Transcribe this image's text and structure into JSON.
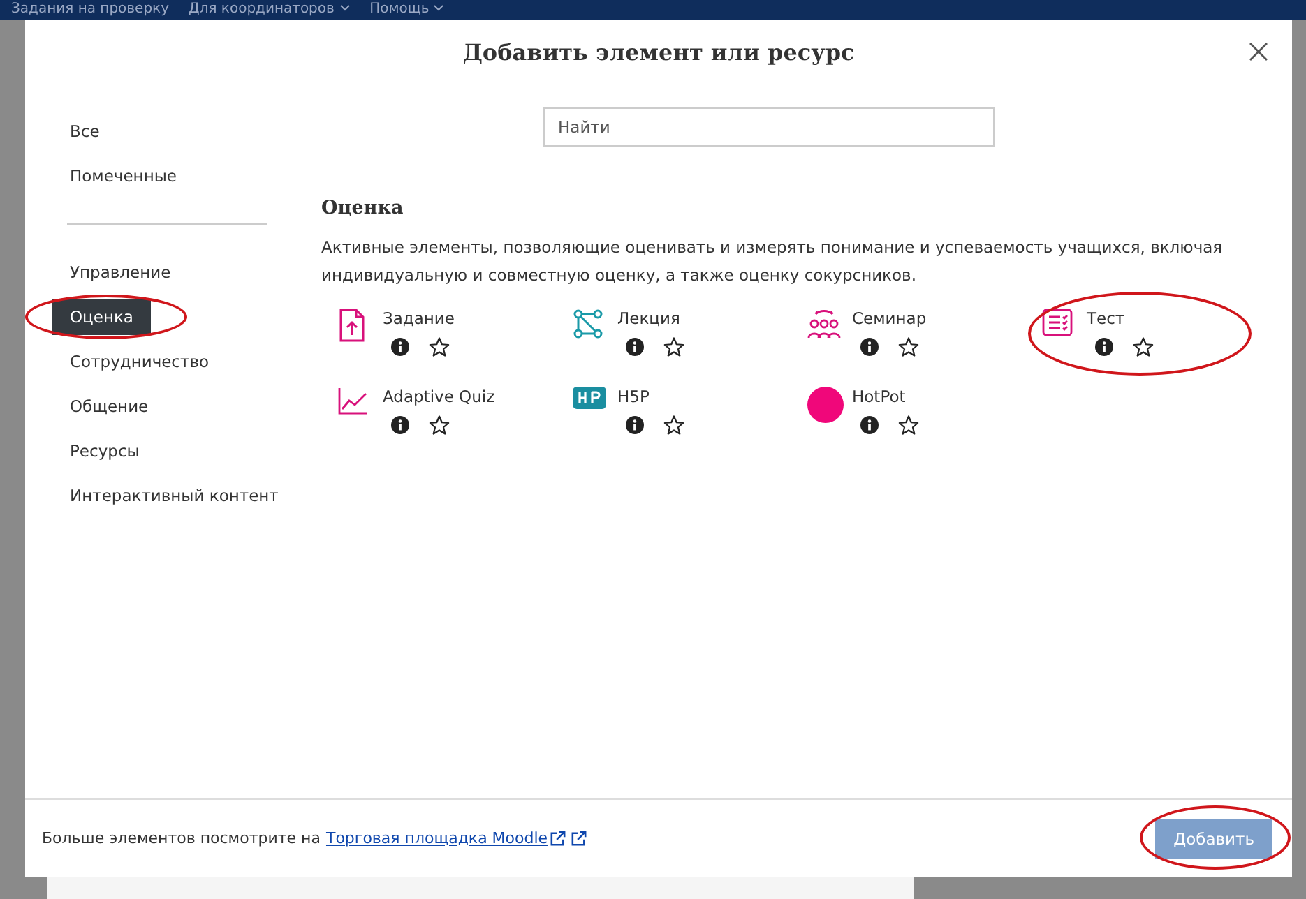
{
  "top_nav": [
    {
      "label": "Задания на проверку",
      "dropdown": false
    },
    {
      "label": "Для координаторов",
      "dropdown": true
    },
    {
      "label": "Помощь",
      "dropdown": true
    }
  ],
  "modal": {
    "title": "Добавить элемент или ресурс",
    "sidebar": {
      "filters": [
        {
          "label": "Все",
          "selected": false,
          "highlighted": false
        },
        {
          "label": "Помеченные",
          "selected": false,
          "highlighted": false
        }
      ],
      "categories": [
        {
          "label": "Управление",
          "selected": false,
          "highlighted": false
        },
        {
          "label": "Оценка",
          "selected": true,
          "highlighted": true
        },
        {
          "label": "Сотрудничество",
          "selected": false,
          "highlighted": false
        },
        {
          "label": "Общение",
          "selected": false,
          "highlighted": false
        },
        {
          "label": "Ресурсы",
          "selected": false,
          "highlighted": false
        },
        {
          "label": "Интерактивный контент",
          "selected": false,
          "highlighted": false
        }
      ]
    },
    "search": {
      "placeholder": "Найти"
    },
    "section": {
      "title": "Оценка",
      "description": "Активные элементы, позволяющие оценивать и измерять понимание и успеваемость учащихся, включая индивидуальную и совместную оценку, а также оценку сокурсников."
    },
    "items": [
      {
        "name": "Задание",
        "kind": "assignment",
        "starred": false,
        "highlighted": false
      },
      {
        "name": "Лекция",
        "kind": "lesson",
        "starred": false,
        "highlighted": false
      },
      {
        "name": "Семинар",
        "kind": "workshop",
        "starred": false,
        "highlighted": false
      },
      {
        "name": "Тест",
        "kind": "quiz",
        "starred": false,
        "highlighted": true
      },
      {
        "name": "Adaptive Quiz",
        "kind": "chart",
        "starred": false,
        "highlighted": false
      },
      {
        "name": "H5P",
        "kind": "h5p",
        "starred": false,
        "highlighted": false
      },
      {
        "name": "HotPot",
        "kind": "hotpot",
        "starred": false,
        "highlighted": false
      }
    ],
    "footer": {
      "text": "Больше элементов посмотрите на",
      "link": "Торговая площадка Moodle",
      "button": {
        "label": "Добавить",
        "highlighted": true
      }
    }
  }
}
